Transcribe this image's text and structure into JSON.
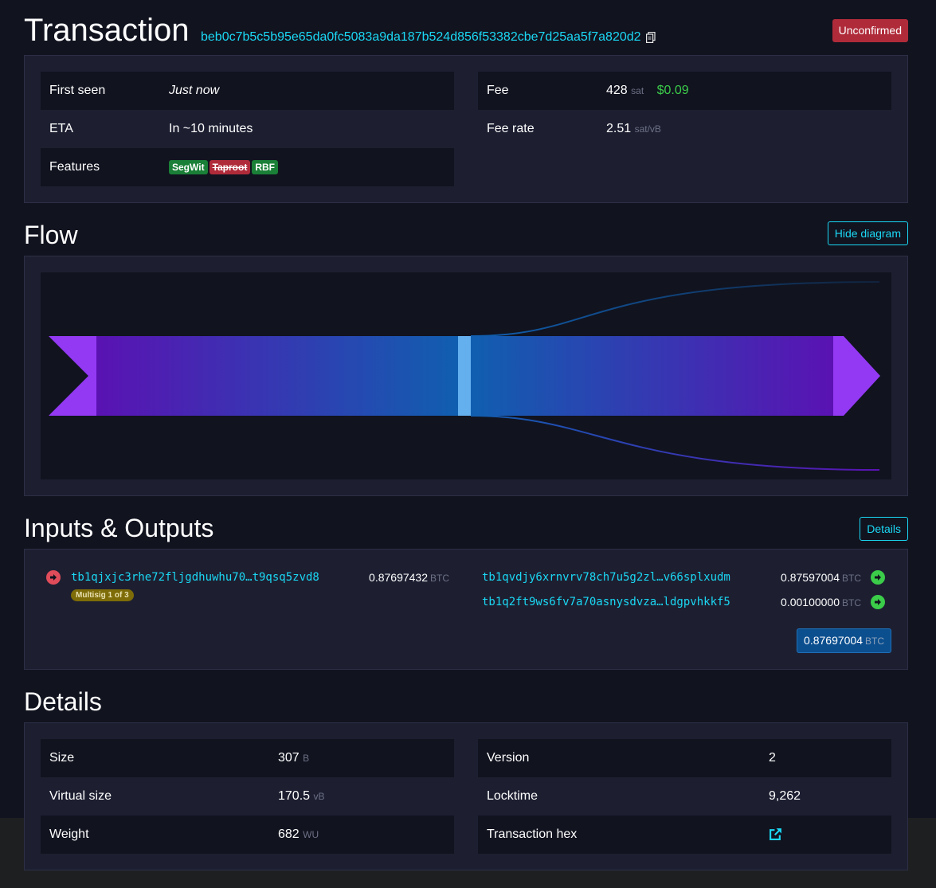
{
  "header": {
    "title": "Transaction",
    "txid": "beb0c7b5c5b95e65da0fc5083a9da187b524d856f53382cbe7d25aa5f7a820d2",
    "status": "Unconfirmed"
  },
  "summary": {
    "first_seen_label": "First seen",
    "first_seen_value": "Just now",
    "eta_label": "ETA",
    "eta_value": "In ~10 minutes",
    "features_label": "Features",
    "features": [
      "SegWit",
      "Taproot",
      "RBF"
    ],
    "fee_label": "Fee",
    "fee_value": "428",
    "fee_unit": "sat",
    "fee_usd": "$0.09",
    "fee_rate_label": "Fee rate",
    "fee_rate_value": "2.51",
    "fee_rate_unit": "sat/vB"
  },
  "flow": {
    "title": "Flow",
    "toggle_label": "Hide diagram"
  },
  "io": {
    "title": "Inputs & Outputs",
    "details_button": "Details",
    "inputs": [
      {
        "address": "tb1qjxjc3rhe72fljgdhuwhu70…t9qsq5zvd8",
        "amount": "0.87697432",
        "unit": "BTC",
        "tag": "Multisig 1 of 3"
      }
    ],
    "outputs": [
      {
        "address": "tb1qvdjy6xrnvrv78ch7u5g2zl…v66splxudm",
        "amount": "0.87597004",
        "unit": "BTC"
      },
      {
        "address": "tb1q2ft9ws6fv7a70asnysdvza…ldgpvhkkf5",
        "amount": "0.00100000",
        "unit": "BTC"
      }
    ],
    "total": "0.87697004",
    "total_unit": "BTC"
  },
  "details": {
    "title": "Details",
    "size_label": "Size",
    "size_value": "307",
    "size_unit": "B",
    "vsize_label": "Virtual size",
    "vsize_value": "170.5",
    "vsize_unit": "vB",
    "weight_label": "Weight",
    "weight_value": "682",
    "weight_unit": "WU",
    "version_label": "Version",
    "version_value": "2",
    "locktime_label": "Locktime",
    "locktime_value": "9,262",
    "hex_label": "Transaction hex"
  },
  "colors": {
    "background": "#11131f",
    "panel": "#1d1f31",
    "link": "#1bd8f4",
    "danger": "#b02b3a",
    "success": "#3bcc49",
    "flow_purple": "#9339f4",
    "flow_blue": "#105fb0"
  }
}
